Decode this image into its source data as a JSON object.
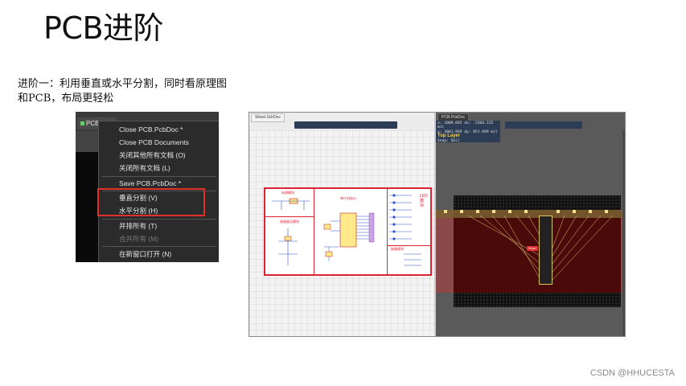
{
  "slide": {
    "title": "PCB进阶",
    "description": "进阶一：利用垂直或水平分割，同时看原理图和PCB，布局更轻松",
    "watermark": "CSDN @HHUCESTA"
  },
  "context_menu_shot": {
    "tab_label": "PCB.PcbDoc",
    "items": [
      {
        "label": "Close PCB.PcbDoc *",
        "disabled": false
      },
      {
        "label": "Close PCB Documents",
        "disabled": false
      },
      {
        "label": "关闭其他所有文档 (O)",
        "disabled": false
      },
      {
        "label": "关闭所有文档 (L)",
        "disabled": false
      },
      {
        "label": "Save PCB.PcbDoc *",
        "disabled": false
      },
      {
        "label": "垂直分割 (V)",
        "disabled": false
      },
      {
        "label": "水平分割 (H)",
        "disabled": false
      },
      {
        "label": "并排所有 (T)",
        "disabled": false
      },
      {
        "label": "合并所有 (M)",
        "disabled": true
      },
      {
        "label": "在新窗口打开 (N)",
        "disabled": false
      }
    ],
    "highlight_color": "#e0302a"
  },
  "split_view_shot": {
    "schematic_tab": "Sheet.SchDoc",
    "pcb_tab": "PCB.PcbDoc",
    "schematic_blocks": [
      {
        "label": "电源模块"
      },
      {
        "label": "单片机核心"
      },
      {
        "label": "LED模块"
      },
      {
        "label": "按键复位模块"
      },
      {
        "label": "按键模块"
      }
    ],
    "pcb_info": {
      "line1": "x: 2009.685  dx: -2360.315 mil",
      "line2": "y: 3061.949  dy:  851.949 mil",
      "layer": "Top Layer",
      "snap": "Snap: 5mil"
    },
    "pcb_label": "Short"
  }
}
